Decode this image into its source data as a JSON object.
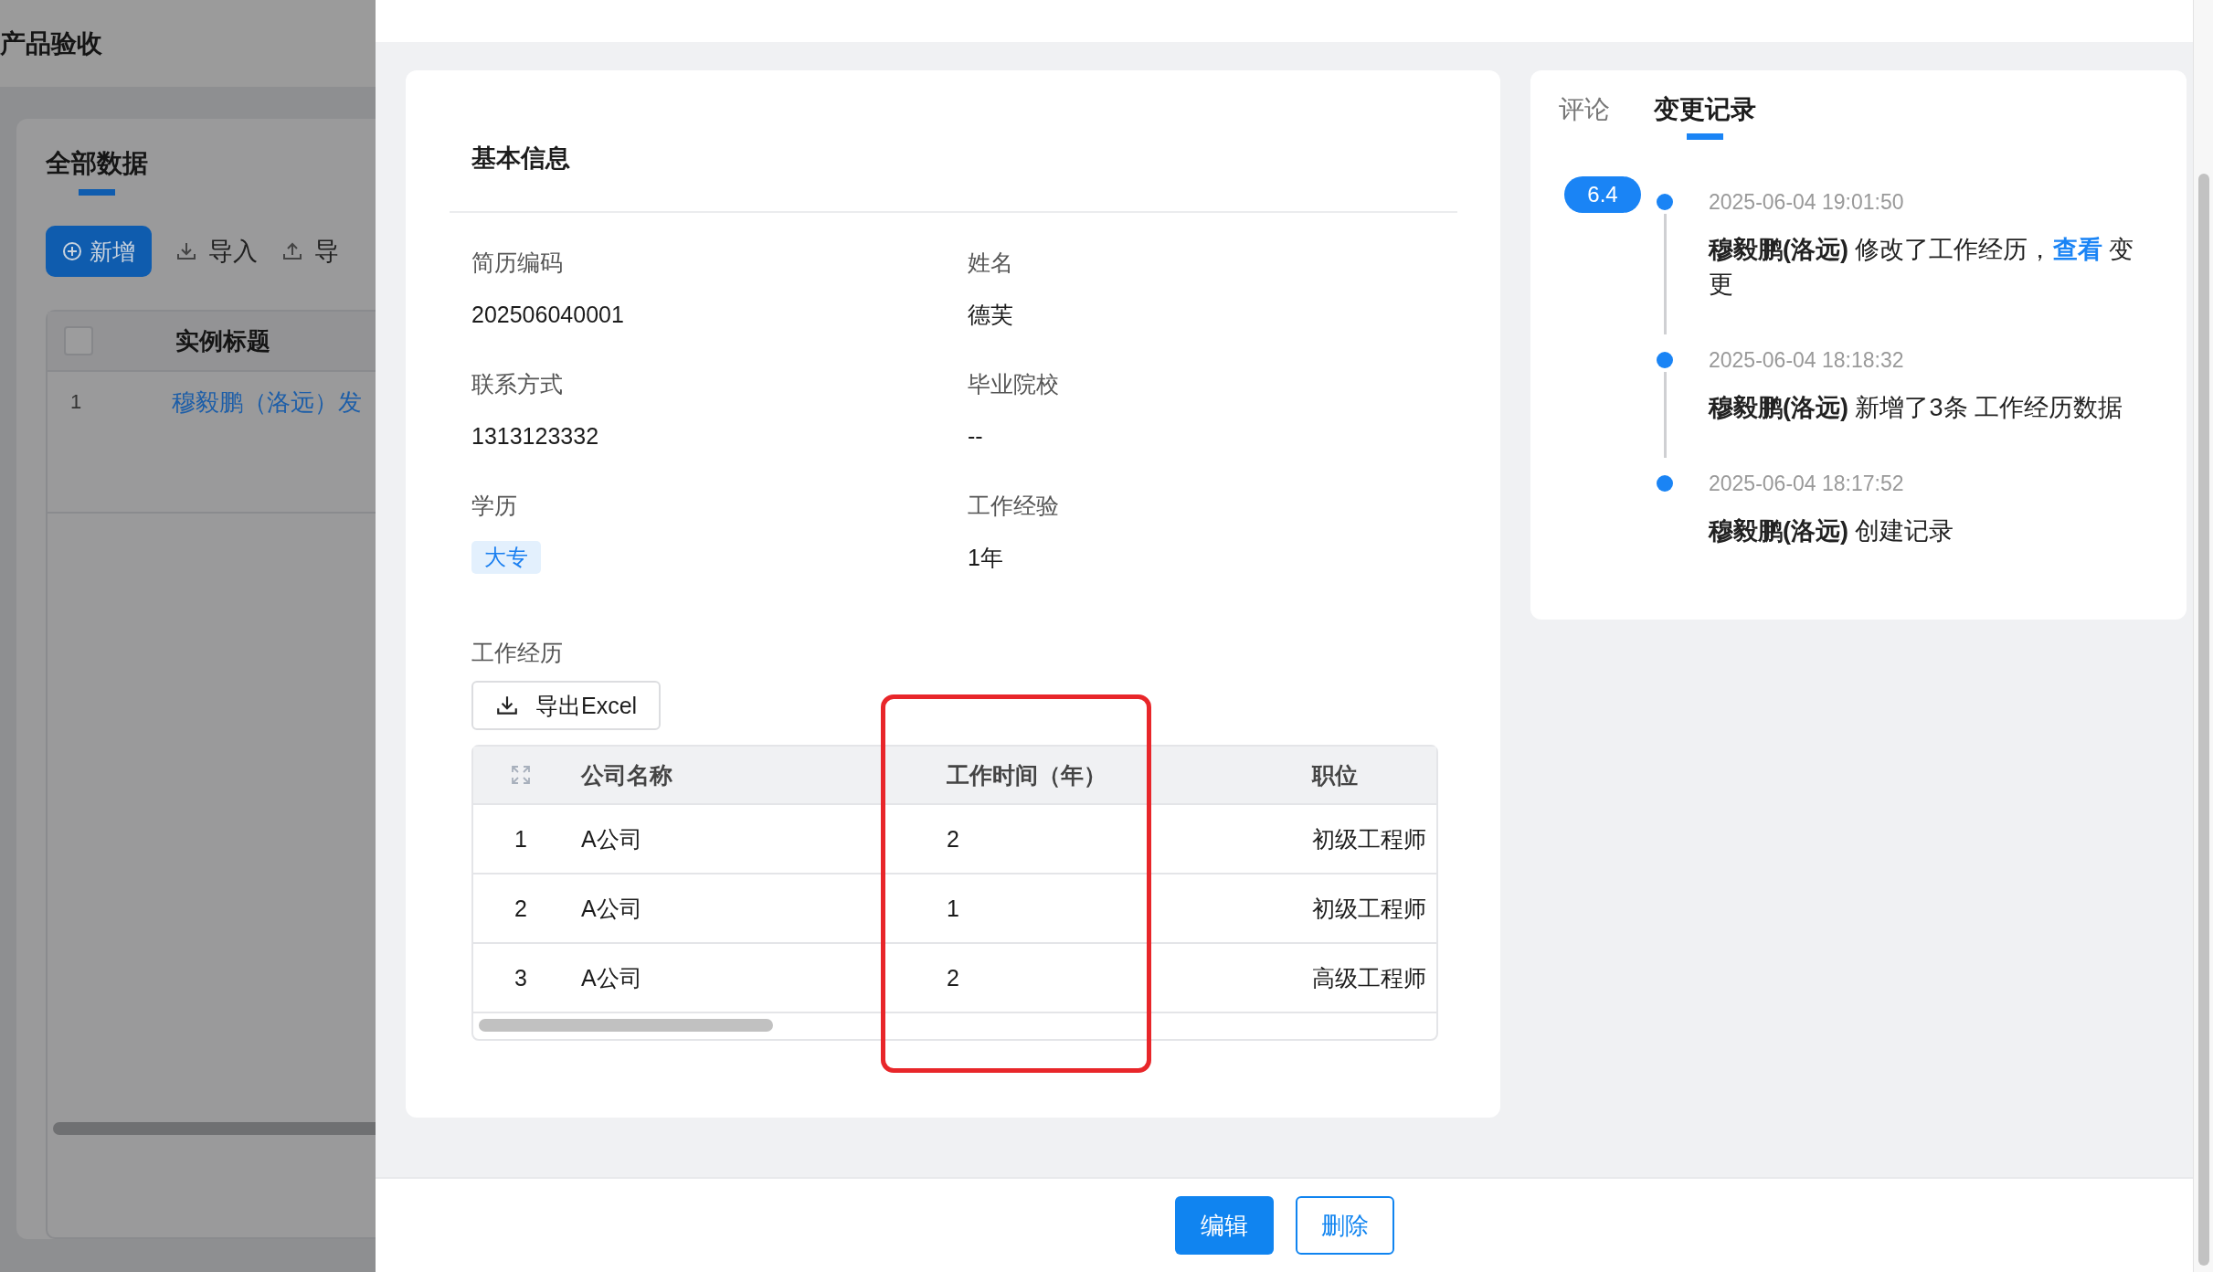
{
  "background_page": {
    "title": "产品验收",
    "tabs": [
      {
        "label": "全部数据",
        "selected": true
      }
    ],
    "toolbar": [
      {
        "label": "新增",
        "kind": "primary"
      },
      {
        "label": "导入",
        "kind": "import"
      },
      {
        "label": "导",
        "kind": "export"
      }
    ],
    "table": {
      "select_all": {
        "checked": false
      },
      "columns": [
        "实例标题"
      ],
      "rows": [
        {
          "index": "1",
          "title": "穆毅鹏（洛远）发"
        }
      ]
    }
  },
  "detail": {
    "section_title": "基本信息",
    "fields": [
      {
        "label": "简历编码",
        "value": "202506040001",
        "kind": "text"
      },
      {
        "label": "姓名",
        "value": "德芙",
        "kind": "text"
      },
      {
        "label": "联系方式",
        "value": "1313123332",
        "kind": "text"
      },
      {
        "label": "毕业院校",
        "value": "--",
        "kind": "text"
      },
      {
        "label": "学历",
        "value": "大专",
        "kind": "tag"
      },
      {
        "label": "工作经验",
        "value": "1年",
        "kind": "text"
      }
    ],
    "work_history": {
      "label": "工作经历",
      "export_button": "导出Excel",
      "columns": [
        {
          "label": "公司名称",
          "highlighted": false
        },
        {
          "label": "工作时间（年）",
          "highlighted": true
        },
        {
          "label": "职位",
          "highlighted": false
        }
      ],
      "rows": [
        {
          "index": "1",
          "cells": [
            "A公司",
            "2",
            "初级工程师"
          ]
        },
        {
          "index": "2",
          "cells": [
            "A公司",
            "1",
            "初级工程师"
          ]
        },
        {
          "index": "3",
          "cells": [
            "A公司",
            "2",
            "高级工程师"
          ]
        }
      ]
    }
  },
  "side_panel": {
    "tabs": [
      {
        "label": "评论",
        "selected": false
      },
      {
        "label": "变更记录",
        "selected": true
      }
    ],
    "timeline": [
      {
        "badge": "6.4",
        "time": "2025-06-04 19:01:50",
        "message": "**穆毅鹏(洛远)** 修改了工作经历，",
        "link": "查看",
        "message_end": " 变更"
      },
      {
        "time": "2025-06-04 18:18:32",
        "message": "**穆毅鹏(洛远)** 新增了3条  工作经历数据"
      },
      {
        "time": "2025-06-04 18:17:52",
        "message": "**穆毅鹏(洛远)** 创建记录"
      }
    ]
  },
  "footer_buttons": [
    {
      "label": "编辑",
      "kind": "primary"
    },
    {
      "label": "删除",
      "kind": "outline"
    }
  ]
}
